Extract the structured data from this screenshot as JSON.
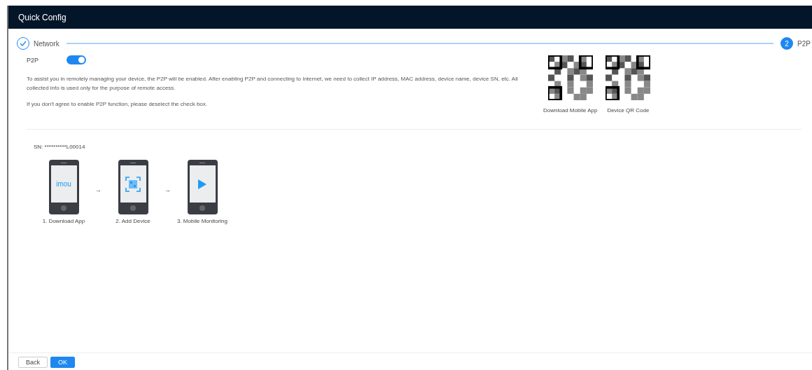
{
  "window": {
    "title": "Quick Config"
  },
  "steps": [
    {
      "label": "Network",
      "completed": true
    },
    {
      "label": "P2P",
      "number": "2",
      "completed": false
    }
  ],
  "p2p": {
    "label": "P2P",
    "on": true,
    "notice": "To assist you in remotely managing your device, the P2P will be enabled. After enabling P2P and connecting to Internet, we need to collect IP address, MAC address, device name, device SN, etc. All collected info is used only for the purpose of remote access.",
    "hint": "If you don't agree to enable P2P function, please deselect the check box."
  },
  "qr_codes": [
    {
      "caption": "Download Mobile App"
    },
    {
      "caption": "Device QR Code"
    }
  ],
  "serial": "SN: **********L00014",
  "guide": [
    {
      "kind": "app",
      "logo": "imou",
      "caption": "1. Download App"
    },
    {
      "kind": "scan",
      "caption": "2. Add Device"
    },
    {
      "kind": "play",
      "caption": "3. Mobile Monitoring"
    }
  ],
  "guide_arrow": "→",
  "buttons": [
    {
      "label": "Back",
      "primary": false
    },
    {
      "label": "OK",
      "primary": true
    }
  ]
}
